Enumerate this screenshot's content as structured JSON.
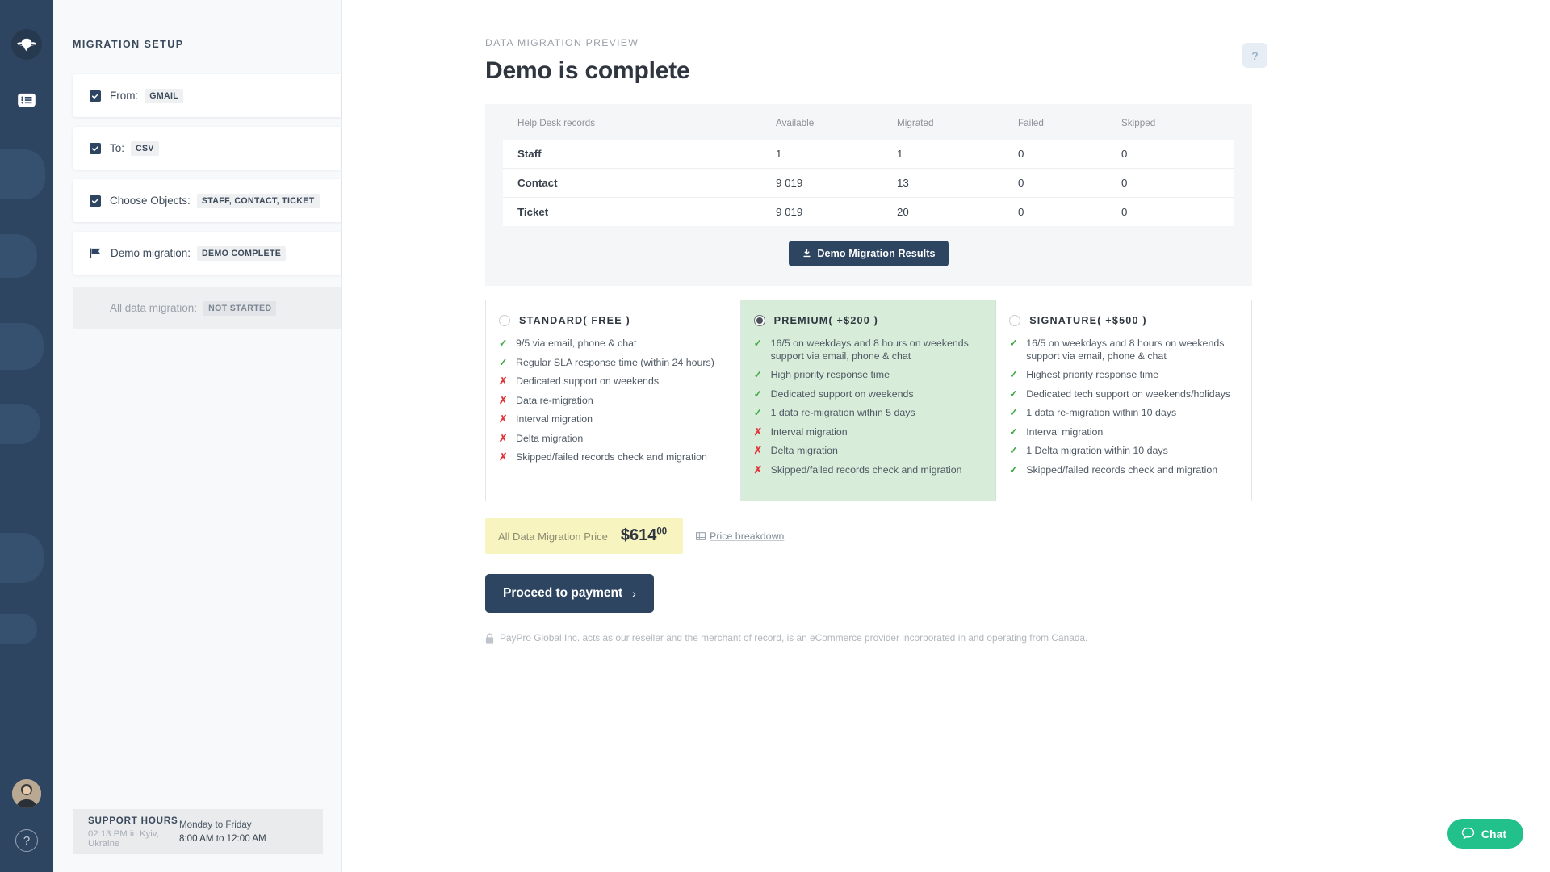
{
  "rail": {
    "logo_icon": "saturn-logo-icon",
    "items": [
      {
        "icon": "list-icon"
      }
    ],
    "avatar_icon": "user-avatar",
    "help_label": "?"
  },
  "sidebar": {
    "title": "MIGRATION SETUP",
    "steps": [
      {
        "marker": "checkbox",
        "checked": true,
        "label": "From:",
        "value": "GMAIL",
        "muted": false
      },
      {
        "marker": "checkbox",
        "checked": true,
        "label": "To:",
        "value": "CSV",
        "muted": false
      },
      {
        "marker": "checkbox",
        "checked": true,
        "label": "Choose Objects:",
        "value": "STAFF, CONTACT, TICKET",
        "muted": false
      },
      {
        "marker": "flag",
        "checked": false,
        "label": "Demo migration:",
        "value": "DEMO COMPLETE",
        "muted": false
      },
      {
        "marker": "none",
        "checked": false,
        "label": "All data migration:",
        "value": "NOT STARTED",
        "muted": true
      }
    ],
    "support": {
      "heading": "SUPPORT HOURS",
      "local_time": "02:13 PM in Kyiv, Ukraine",
      "days": "Monday to Friday",
      "hours": "8:00 AM to 12:00 AM"
    }
  },
  "main": {
    "eyebrow": "DATA MIGRATION PREVIEW",
    "title": "Demo is complete",
    "help_button_label": "?",
    "results": {
      "columns": [
        "Help Desk records",
        "Available",
        "Migrated",
        "Failed",
        "Skipped"
      ],
      "rows": [
        {
          "name": "Staff",
          "available": "1",
          "migrated": "1",
          "failed": "0",
          "skipped": "0"
        },
        {
          "name": "Contact",
          "available": "9 019",
          "migrated": "13",
          "failed": "0",
          "skipped": "0"
        },
        {
          "name": "Ticket",
          "available": "9 019",
          "migrated": "20",
          "failed": "0",
          "skipped": "0"
        }
      ],
      "download_label": "Demo Migration Results",
      "download_icon": "download-icon"
    },
    "plans": [
      {
        "id": "standard",
        "name": "STANDARD( FREE )",
        "selected": false,
        "features": [
          {
            "ok": true,
            "text": "9/5 via email, phone & chat"
          },
          {
            "ok": true,
            "text": "Regular SLA response time (within 24 hours)"
          },
          {
            "ok": false,
            "text": "Dedicated support on weekends"
          },
          {
            "ok": false,
            "text": "Data re-migration"
          },
          {
            "ok": false,
            "text": "Interval migration"
          },
          {
            "ok": false,
            "text": "Delta migration"
          },
          {
            "ok": false,
            "text": "Skipped/failed records check and migration"
          }
        ]
      },
      {
        "id": "premium",
        "name": "PREMIUM( +$200 )",
        "selected": true,
        "features": [
          {
            "ok": true,
            "text": "16/5 on weekdays and 8 hours on weekends support via email, phone & chat"
          },
          {
            "ok": true,
            "text": "High priority response time"
          },
          {
            "ok": true,
            "text": "Dedicated support on weekends"
          },
          {
            "ok": true,
            "text": "1 data re-migration within 5 days"
          },
          {
            "ok": false,
            "text": "Interval migration"
          },
          {
            "ok": false,
            "text": "Delta migration"
          },
          {
            "ok": false,
            "text": "Skipped/failed records check and migration"
          }
        ]
      },
      {
        "id": "signature",
        "name": "SIGNATURE( +$500 )",
        "selected": false,
        "features": [
          {
            "ok": true,
            "text": "16/5 on weekdays and 8 hours on weekends support via email, phone & chat"
          },
          {
            "ok": true,
            "text": "Highest priority response time"
          },
          {
            "ok": true,
            "text": "Dedicated tech support on weekends/holidays"
          },
          {
            "ok": true,
            "text": "1 data re-migration within 10 days"
          },
          {
            "ok": true,
            "text": "Interval migration"
          },
          {
            "ok": true,
            "text": "1 Delta migration within 10 days"
          },
          {
            "ok": true,
            "text": "Skipped/failed records check and migration"
          }
        ]
      }
    ],
    "price": {
      "label": "All Data Migration Price",
      "amount": "$614",
      "cents": "00",
      "breakdown_label": "Price breakdown",
      "breakdown_icon": "table-icon"
    },
    "pay_button": {
      "label": "Proceed to payment",
      "chevron": "›"
    },
    "disclaimer": {
      "icon": "lock-icon",
      "text": "PayPro Global Inc. acts as our reseller and the merchant of record, is an eCommerce provider incorporated in and operating from Canada."
    }
  },
  "chat": {
    "label": "Chat",
    "icon": "chat-bubble-icon",
    "color": "#22c08a"
  },
  "colors": {
    "brand_dark": "#2e4561",
    "selected_plan_bg": "#d7ecd9",
    "price_tag_bg": "#f7f4c0",
    "yes": "#3faa46",
    "no": "#e0383e"
  }
}
